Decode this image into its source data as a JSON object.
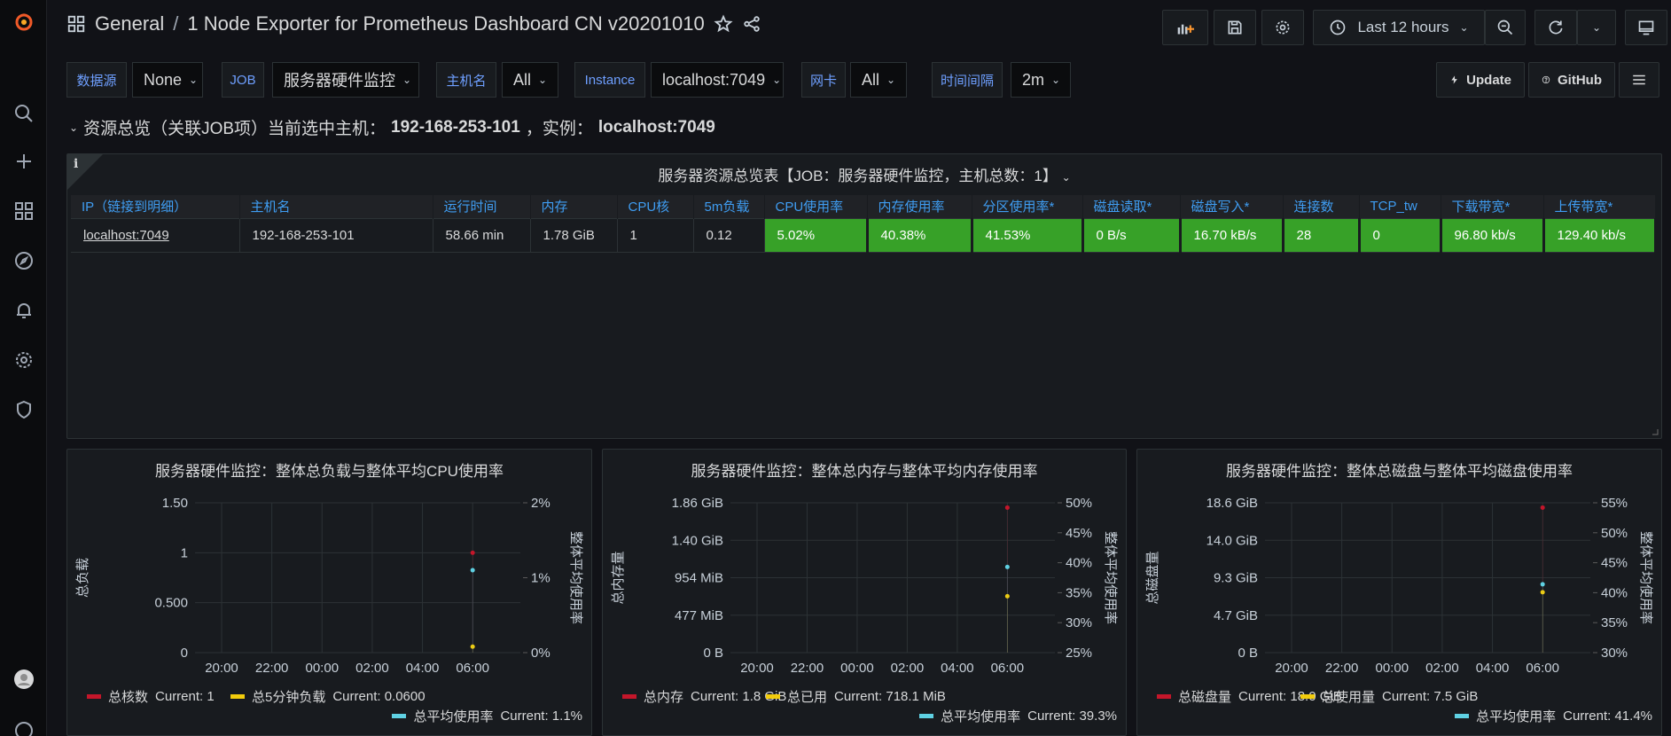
{
  "header": {
    "folder": "General",
    "separator": "/",
    "dashboard_title": "1 Node Exporter for Prometheus Dashboard CN v20201010",
    "time_range": "Last 12 hours"
  },
  "variables": [
    {
      "label": "数据源",
      "value": "None"
    },
    {
      "label": "JOB",
      "value": "服务器硬件监控"
    },
    {
      "label": "主机名",
      "value": "All"
    },
    {
      "label": "Instance",
      "value": "localhost:7049"
    },
    {
      "label": "网卡",
      "value": "All"
    },
    {
      "label": "时间间隔",
      "value": "2m"
    }
  ],
  "links": {
    "update": "Update",
    "github": "GitHub"
  },
  "row": {
    "prefix": "资源总览（关联JOB项）当前选中主机：",
    "host": "192-168-253-101",
    "mid": "，实例：",
    "instance": "localhost:7049"
  },
  "table_panel": {
    "title": "服务器资源总览表【JOB：服务器硬件监控，主机总数：1】",
    "columns": [
      "IP（链接到明细）",
      "主机名",
      "运行时间",
      "内存",
      "CPU核",
      "5m负载",
      "CPU使用率",
      "内存使用率",
      "分区使用率*",
      "磁盘读取*",
      "磁盘写入*",
      "连接数",
      "TCP_tw",
      "下载带宽*",
      "上传带宽*"
    ],
    "rows": [
      [
        "localhost:7049",
        "192-168-253-101",
        "58.66 min",
        "1.78 GiB",
        "1",
        "0.12",
        "5.02%",
        "40.38%",
        "41.53%",
        "0 B/s",
        "16.70 kB/s",
        "28",
        "0",
        "96.80 kb/s",
        "129.40 kb/s"
      ]
    ]
  },
  "colors": {
    "green": "#37a128",
    "red": "#c4162a",
    "yellow": "#f2cc0c",
    "cyan": "#8ab8ff",
    "accent": "#6e9fff"
  },
  "chart_data": [
    {
      "type": "line",
      "title": "服务器硬件监控：整体总负载与整体平均CPU使用率",
      "x_ticks": [
        "20:00",
        "22:00",
        "00:00",
        "02:00",
        "04:00",
        "06:00"
      ],
      "y_left": {
        "label": "总负载",
        "ticks": [
          "0",
          "0.500",
          "1",
          "1.50"
        ],
        "range": [
          0,
          1.5
        ]
      },
      "y_right": {
        "label": "整体平均使用率",
        "ticks": [
          "0%",
          "1%",
          "2%"
        ],
        "range": [
          0,
          2
        ]
      },
      "series": [
        {
          "name": "总核数",
          "axis": "left",
          "color": "#c4162a",
          "points": [
            [
              "06:00",
              1
            ]
          ],
          "current": "Current: 1"
        },
        {
          "name": "总5分钟负载",
          "axis": "left",
          "color": "#f2cc0c",
          "points": [
            [
              "06:00",
              0.06
            ]
          ],
          "current": "Current: 0.0600"
        },
        {
          "name": "总平均使用率",
          "axis": "right",
          "color": "#5fd1e3",
          "points": [
            [
              "06:00",
              1.1
            ]
          ],
          "current": "Current: 1.1%"
        }
      ]
    },
    {
      "type": "line",
      "title": "服务器硬件监控：整体总内存与整体平均内存使用率",
      "x_ticks": [
        "20:00",
        "22:00",
        "00:00",
        "02:00",
        "04:00",
        "06:00"
      ],
      "y_left": {
        "label": "总内存量",
        "ticks": [
          "0 B",
          "477 MiB",
          "954 MiB",
          "1.40 GiB",
          "1.86 GiB"
        ],
        "range": [
          0,
          1.86
        ]
      },
      "y_right": {
        "label": "整体平均使用率",
        "ticks": [
          "25%",
          "30%",
          "35%",
          "40%",
          "45%",
          "50%"
        ],
        "range": [
          25,
          50
        ]
      },
      "series": [
        {
          "name": "总内存",
          "axis": "left",
          "color": "#c4162a",
          "points": [
            [
              "06:00",
              1.8
            ]
          ],
          "current": "Current: 1.8 GiB"
        },
        {
          "name": "总已用",
          "axis": "left",
          "color": "#f2cc0c",
          "points": [
            [
              "06:00",
              0.7
            ]
          ],
          "current": "Current: 718.1 MiB"
        },
        {
          "name": "总平均使用率",
          "axis": "right",
          "color": "#5fd1e3",
          "points": [
            [
              "06:00",
              39.3
            ]
          ],
          "current": "Current: 39.3%"
        }
      ]
    },
    {
      "type": "line",
      "title": "服务器硬件监控：整体总磁盘与整体平均磁盘使用率",
      "x_ticks": [
        "20:00",
        "22:00",
        "00:00",
        "02:00",
        "04:00",
        "06:00"
      ],
      "y_left": {
        "label": "总磁盘量",
        "ticks": [
          "0 B",
          "4.7 GiB",
          "9.3 GiB",
          "14.0 GiB",
          "18.6 GiB"
        ],
        "range": [
          0,
          18.6
        ]
      },
      "y_right": {
        "label": "整体平均使用率",
        "ticks": [
          "30%",
          "35%",
          "40%",
          "45%",
          "50%",
          "55%"
        ],
        "range": [
          30,
          55
        ]
      },
      "series": [
        {
          "name": "总磁盘量",
          "axis": "left",
          "color": "#c4162a",
          "points": [
            [
              "06:00",
              18.0
            ]
          ],
          "current": "Current: 18.0 GiB"
        },
        {
          "name": "总使用量",
          "axis": "left",
          "color": "#f2cc0c",
          "points": [
            [
              "06:00",
              7.5
            ]
          ],
          "current": "Current: 7.5 GiB"
        },
        {
          "name": "总平均使用率",
          "axis": "right",
          "color": "#5fd1e3",
          "points": [
            [
              "06:00",
              41.4
            ]
          ],
          "current": "Current: 41.4%"
        }
      ]
    }
  ]
}
